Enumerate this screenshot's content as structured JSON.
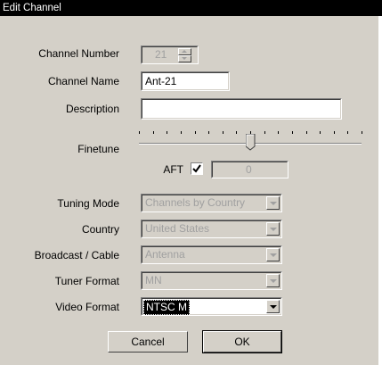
{
  "window": {
    "title": "Edit Channel"
  },
  "fields": {
    "channel_number": {
      "label": "Channel Number",
      "value": "21"
    },
    "channel_name": {
      "label": "Channel Name",
      "value": "Ant-21"
    },
    "description": {
      "label": "Description",
      "value": ""
    },
    "finetune": {
      "label": "Finetune",
      "level": 0.5
    },
    "aft": {
      "label": "AFT",
      "checked": true,
      "value": "0"
    },
    "tuning_mode": {
      "label": "Tuning Mode",
      "value": "Channels by Country"
    },
    "country": {
      "label": "Country",
      "value": "United States"
    },
    "broadcast_cable": {
      "label": "Broadcast / Cable",
      "value": "Antenna"
    },
    "tuner_format": {
      "label": "Tuner Format",
      "value": "MN"
    },
    "video_format": {
      "label": "Video Format",
      "value": "NTSC M"
    }
  },
  "buttons": {
    "cancel": "Cancel",
    "ok": "OK"
  },
  "icons": [
    "spinner-up-icon",
    "spinner-down-icon",
    "checkbox-check-icon",
    "chevron-down-icon",
    "slider-thumb-icon"
  ]
}
